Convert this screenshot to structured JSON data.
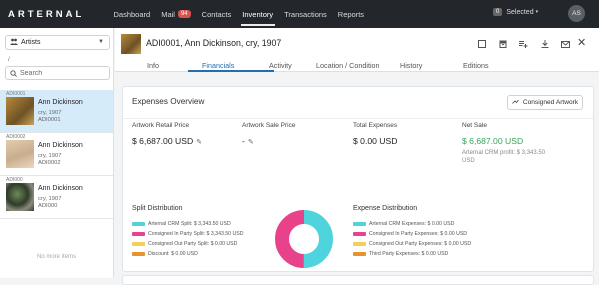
{
  "app": {
    "brand": "ARTERNAL",
    "nav": [
      {
        "label": "Dashboard"
      },
      {
        "label": "Mail",
        "badge": "94"
      },
      {
        "label": "Contacts"
      },
      {
        "label": "Inventory",
        "active": true
      },
      {
        "label": "Transactions"
      },
      {
        "label": "Reports"
      }
    ],
    "selected_count": "0",
    "selected_label": "Selected",
    "avatar_initials": "AS"
  },
  "sidebar": {
    "filter_label": "Artists",
    "path": "/",
    "search_placeholder": "Search",
    "items": [
      {
        "code": "ADI0001",
        "name": "Ann Dickinson",
        "title": "cry, 1907",
        "ref": "ADI0001",
        "active": true
      },
      {
        "code": "ADI0002",
        "name": "Ann Dickinson",
        "title": "cry, 1907",
        "ref": "ADI0002",
        "active": false
      },
      {
        "code": "ADI000",
        "name": "Ann Dickinson",
        "title": "cry, 1907",
        "ref": "ADI000",
        "active": false
      }
    ],
    "no_more": "No more items"
  },
  "detail": {
    "title": "ADI0001, Ann Dickinson, cry, 1907",
    "tabs": [
      "Info",
      "Financials",
      "Activity",
      "Location / Condition",
      "History",
      "Editions"
    ],
    "active_tab": "Financials"
  },
  "expenses": {
    "heading": "Expenses Overview",
    "consigned_button": "Consigned Artwork",
    "retail_label": "Artwork Retail Price",
    "retail_value": "$ 6,687.00 USD",
    "sale_label": "Artwork Sale Price",
    "sale_value": "-",
    "total_label": "Total Expenses",
    "total_value": "$ 0.00 USD",
    "net_label": "Net Sale",
    "net_value": "$ 6,687.00 USD",
    "crm_profit_line1": "Arternal CRM profit: $ 3,343.50",
    "crm_profit_line2": "USD"
  },
  "split": {
    "heading": "Split Distribution",
    "legend": [
      {
        "label": "Arternal CRM Split:  $ 3,343.50 USD",
        "color": "#4fd3dc"
      },
      {
        "label": "Consigned In Party Split:  $ 3,343.50 USD",
        "color": "#e8438a"
      },
      {
        "label": "Consigned Out Party Split:  $ 0.00 USD",
        "color": "#f2cf5b"
      },
      {
        "label": "Discount:  $ 0.00 USD",
        "color": "#e8922e"
      }
    ],
    "values": [
      3343.5,
      3343.5,
      0,
      0
    ]
  },
  "expense_dist": {
    "heading": "Expense Distribution",
    "legend": [
      {
        "label": "Arternal CRM Expenses:  $ 0.00 USD",
        "color": "#4fd3dc"
      },
      {
        "label": "Consigned In Party Expenses:  $ 0.00 USD",
        "color": "#e8438a"
      },
      {
        "label": "Consigned Out Party Expenses:  $ 0.00 USD",
        "color": "#f2cf5b"
      },
      {
        "label": "Third Party Expenses:  $ 0.00 USD",
        "color": "#e8922e"
      }
    ]
  }
}
